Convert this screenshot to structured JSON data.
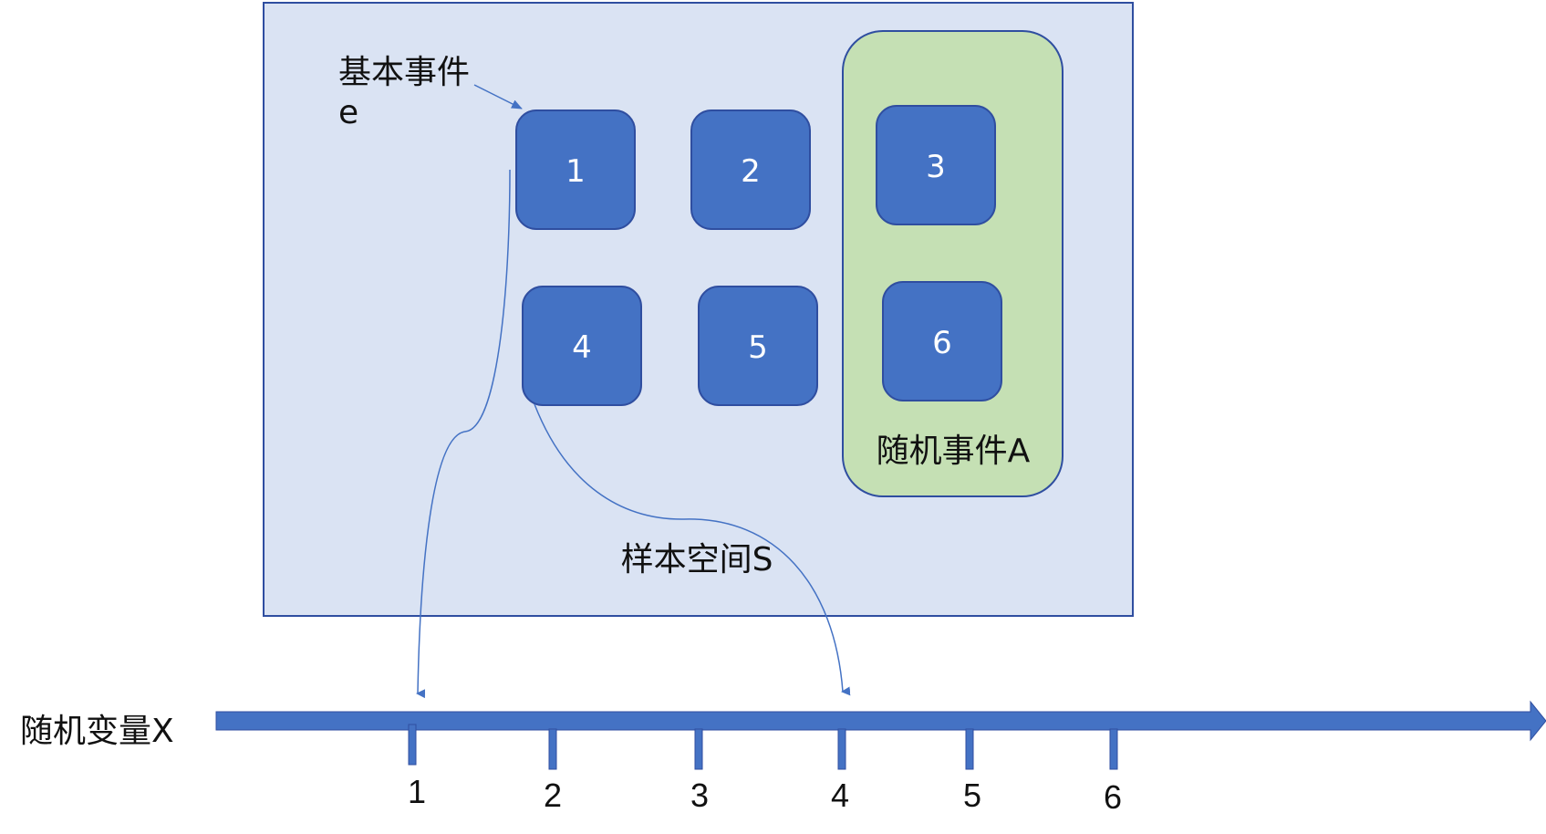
{
  "sample_space": {
    "label": "样本空间S",
    "fill": "#dae3f3",
    "stroke": "#2f4ea0"
  },
  "elementary_event": {
    "label_line1": "基本事件",
    "label_line2": "e"
  },
  "event_a": {
    "label": "随机事件A",
    "fill": "#c5e0b4",
    "stroke": "#2f4ea0"
  },
  "outcomes": [
    {
      "label": "1"
    },
    {
      "label": "2"
    },
    {
      "label": "3"
    },
    {
      "label": "4"
    },
    {
      "label": "5"
    },
    {
      "label": "6"
    }
  ],
  "outcome_style": {
    "fill": "#4472c4",
    "stroke": "#2f4ea0"
  },
  "axis": {
    "label": "随机变量X",
    "color": "#4472c4",
    "ticks": [
      {
        "label": "1"
      },
      {
        "label": "2"
      },
      {
        "label": "3"
      },
      {
        "label": "4"
      },
      {
        "label": "5"
      },
      {
        "label": "6"
      }
    ]
  },
  "connector_color": "#4472c4"
}
